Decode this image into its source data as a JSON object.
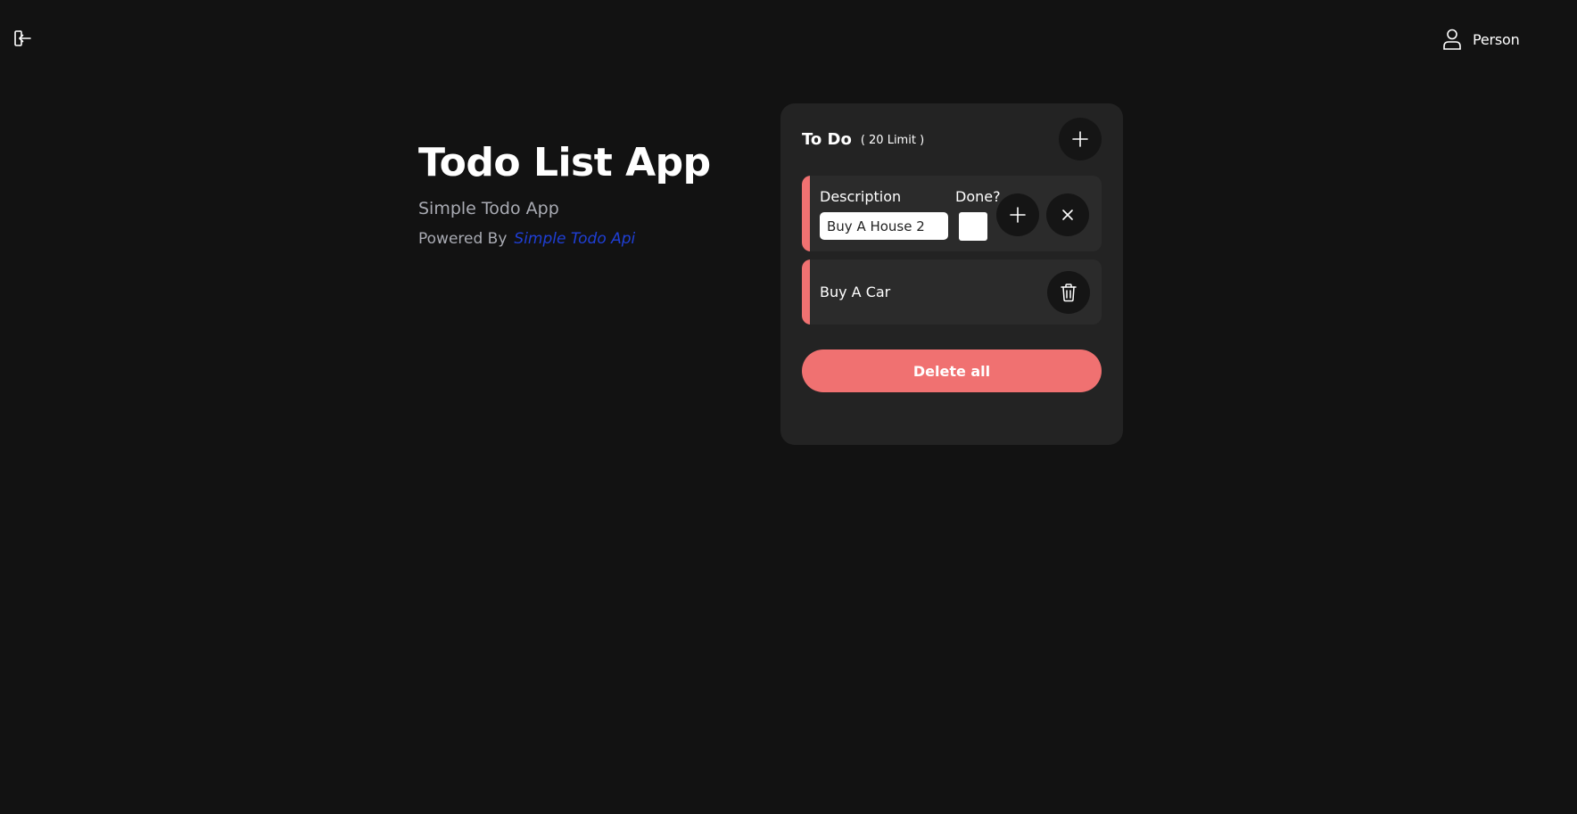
{
  "topbar": {
    "logout_icon": "logout-icon",
    "user_icon": "user-icon",
    "user_name": "Person"
  },
  "hero": {
    "title": "Todo List App",
    "subtitle": "Simple Todo App",
    "powered_by": "Powered By",
    "api_link": "Simple Todo Api"
  },
  "card": {
    "title": "To Do",
    "limit": "( 20 Limit )",
    "add_icon": "plus-icon",
    "edit_item": {
      "description_label": "Description",
      "description_value": "Buy A House 2",
      "done_label": "Done?",
      "done_checked": false,
      "add_icon": "plus-icon",
      "cancel_icon": "close-icon"
    },
    "items": [
      {
        "label": "Buy A Car",
        "delete_icon": "trash-icon"
      }
    ],
    "delete_all_label": "Delete all"
  },
  "colors": {
    "background": "#121212",
    "card": "#232323",
    "accent": "#f07171",
    "link": "#1f3fd6",
    "muted_text": "#a9abb3"
  }
}
